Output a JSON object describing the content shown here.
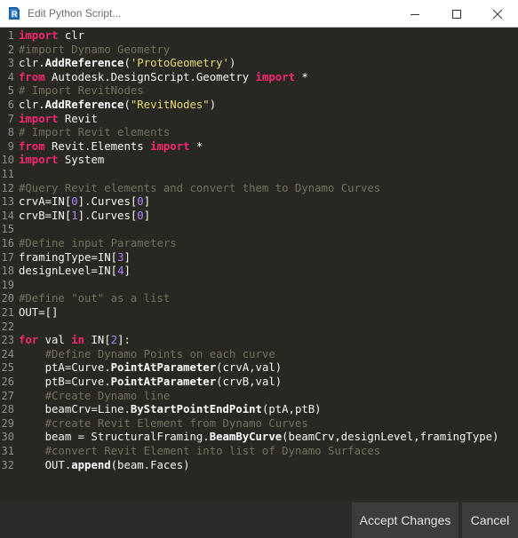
{
  "window": {
    "title": "Edit Python Script...",
    "icon": "revit-logo-icon"
  },
  "editor": {
    "lines": [
      {
        "n": "1",
        "tokens": [
          [
            "kw",
            "import"
          ],
          [
            "t",
            " clr"
          ]
        ]
      },
      {
        "n": "2",
        "tokens": [
          [
            "cm",
            "#import Dynamo Geometry"
          ]
        ]
      },
      {
        "n": "3",
        "tokens": [
          [
            "t",
            "clr."
          ],
          [
            "fn",
            "AddReference"
          ],
          [
            "t",
            "("
          ],
          [
            "st",
            "'ProtoGeometry'"
          ],
          [
            "t",
            ")"
          ]
        ]
      },
      {
        "n": "4",
        "tokens": [
          [
            "kw",
            "from"
          ],
          [
            "t",
            " Autodesk.DesignScript.Geometry "
          ],
          [
            "kw",
            "import"
          ],
          [
            "t",
            " *"
          ]
        ]
      },
      {
        "n": "5",
        "tokens": [
          [
            "cm",
            "# Import RevitNodes"
          ]
        ]
      },
      {
        "n": "6",
        "tokens": [
          [
            "t",
            "clr."
          ],
          [
            "fn",
            "AddReference"
          ],
          [
            "t",
            "("
          ],
          [
            "st",
            "\"RevitNodes\""
          ],
          [
            "t",
            ")"
          ]
        ]
      },
      {
        "n": "7",
        "tokens": [
          [
            "kw",
            "import"
          ],
          [
            "t",
            " Revit"
          ]
        ]
      },
      {
        "n": "8",
        "tokens": [
          [
            "cm",
            "# Import Revit elements"
          ]
        ]
      },
      {
        "n": "9",
        "tokens": [
          [
            "kw",
            "from"
          ],
          [
            "t",
            " Revit.Elements "
          ],
          [
            "kw",
            "import"
          ],
          [
            "t",
            " *"
          ]
        ]
      },
      {
        "n": "10",
        "tokens": [
          [
            "kw",
            "import"
          ],
          [
            "t",
            " System"
          ]
        ]
      },
      {
        "n": "11",
        "tokens": []
      },
      {
        "n": "12",
        "tokens": [
          [
            "cm",
            "#Query Revit elements and convert them to Dynamo Curves"
          ]
        ]
      },
      {
        "n": "13",
        "tokens": [
          [
            "t",
            "crvA=IN["
          ],
          [
            "nm",
            "0"
          ],
          [
            "t",
            "].Curves["
          ],
          [
            "nm",
            "0"
          ],
          [
            "t",
            "]"
          ]
        ]
      },
      {
        "n": "14",
        "tokens": [
          [
            "t",
            "crvB=IN["
          ],
          [
            "nm",
            "1"
          ],
          [
            "t",
            "].Curves["
          ],
          [
            "nm",
            "0"
          ],
          [
            "t",
            "]"
          ]
        ]
      },
      {
        "n": "15",
        "tokens": []
      },
      {
        "n": "16",
        "tokens": [
          [
            "cm",
            "#Define input Parameters"
          ]
        ]
      },
      {
        "n": "17",
        "tokens": [
          [
            "t",
            "framingType=IN["
          ],
          [
            "nm",
            "3"
          ],
          [
            "t",
            "]"
          ]
        ]
      },
      {
        "n": "18",
        "tokens": [
          [
            "t",
            "designLevel=IN["
          ],
          [
            "nm",
            "4"
          ],
          [
            "t",
            "]"
          ]
        ]
      },
      {
        "n": "19",
        "tokens": []
      },
      {
        "n": "20",
        "tokens": [
          [
            "cm",
            "#Define \"out\" as a list"
          ]
        ]
      },
      {
        "n": "21",
        "tokens": [
          [
            "t",
            "OUT=[]"
          ]
        ]
      },
      {
        "n": "22",
        "tokens": []
      },
      {
        "n": "23",
        "tokens": [
          [
            "kw",
            "for"
          ],
          [
            "t",
            " val "
          ],
          [
            "kw",
            "in"
          ],
          [
            "t",
            " IN["
          ],
          [
            "nm",
            "2"
          ],
          [
            "t",
            "]:"
          ]
        ]
      },
      {
        "n": "24",
        "tokens": [
          [
            "t",
            "    "
          ],
          [
            "cm",
            "#Define Dynamo Points on each curve"
          ]
        ]
      },
      {
        "n": "25",
        "tokens": [
          [
            "t",
            "    ptA=Curve."
          ],
          [
            "fn",
            "PointAtParameter"
          ],
          [
            "t",
            "(crvA,val)"
          ]
        ]
      },
      {
        "n": "26",
        "tokens": [
          [
            "t",
            "    ptB=Curve."
          ],
          [
            "fn",
            "PointAtParameter"
          ],
          [
            "t",
            "(crvB,val)"
          ]
        ]
      },
      {
        "n": "27",
        "tokens": [
          [
            "t",
            "    "
          ],
          [
            "cm",
            "#Create Dynamo line"
          ]
        ]
      },
      {
        "n": "28",
        "tokens": [
          [
            "t",
            "    beamCrv=Line."
          ],
          [
            "fn",
            "ByStartPointEndPoint"
          ],
          [
            "t",
            "(ptA,ptB)"
          ]
        ]
      },
      {
        "n": "29",
        "tokens": [
          [
            "t",
            "    "
          ],
          [
            "cm",
            "#create Revit Element from Dynamo Curves"
          ]
        ]
      },
      {
        "n": "30",
        "tokens": [
          [
            "t",
            "    beam = StructuralFraming."
          ],
          [
            "fn",
            "BeamByCurve"
          ],
          [
            "t",
            "(beamCrv,designLevel,framingType)"
          ]
        ]
      },
      {
        "n": "31",
        "tokens": [
          [
            "t",
            "    "
          ],
          [
            "cm",
            "#convert Revit Element into list of Dynamo Surfaces"
          ]
        ]
      },
      {
        "n": "32",
        "tokens": [
          [
            "t",
            "    OUT."
          ],
          [
            "fn",
            "append"
          ],
          [
            "t",
            "(beam.Faces)"
          ]
        ]
      }
    ]
  },
  "footer": {
    "accept_label": "Accept Changes",
    "cancel_label": "Cancel"
  },
  "colors": {
    "editor_bg": "#272822",
    "keyword": "#f92672",
    "comment": "#75715e",
    "string": "#e6db74",
    "number": "#ae81ff",
    "text": "#f8f8f2"
  }
}
